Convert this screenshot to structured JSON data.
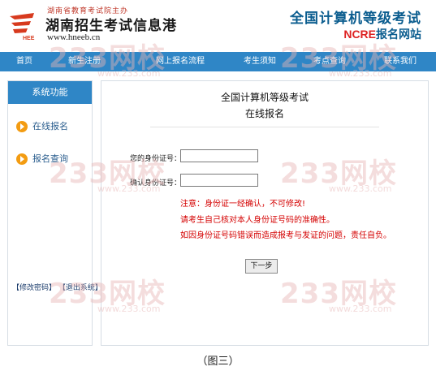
{
  "header": {
    "org_subtitle": "湖南省教育考试院主办",
    "org_title": "湖南招生考试信息港",
    "org_url": "www.hneeb.cn",
    "right_title": "全国计算机等级考试",
    "right_sub_ncre": "NCRE",
    "right_sub_rest": "报名网站",
    "logo_icon": "hee-logo-icon"
  },
  "nav": {
    "items": [
      "首页",
      "新生注册",
      "网上报名流程",
      "考生须知",
      "考点查询",
      "联系我们"
    ]
  },
  "sidebar": {
    "heading": "系统功能",
    "links": [
      "在线报名",
      "报名查询"
    ],
    "actions": "【修改密码】 【退出系统】"
  },
  "main": {
    "title1": "全国计算机等级考试",
    "title2": "在线报名",
    "id_label": "您的身份证号：",
    "id_value": "",
    "confirm_label": "确认身份证号：",
    "confirm_value": "",
    "notices": [
      "注意：身份证一经确认，不可修改!",
      "请考生自己核对本人身份证号码的准确性。",
      "如因身份证号码错误而造成报考与发证的问题，责任自负。"
    ],
    "next_button": "下一步"
  },
  "watermark": {
    "text": "233网校",
    "url": "www.233.com"
  },
  "caption": "（图三）",
  "colors": {
    "nav_blue": "#2f86c6",
    "notice_red": "#d40000",
    "accent_orange": "#f39c12"
  }
}
